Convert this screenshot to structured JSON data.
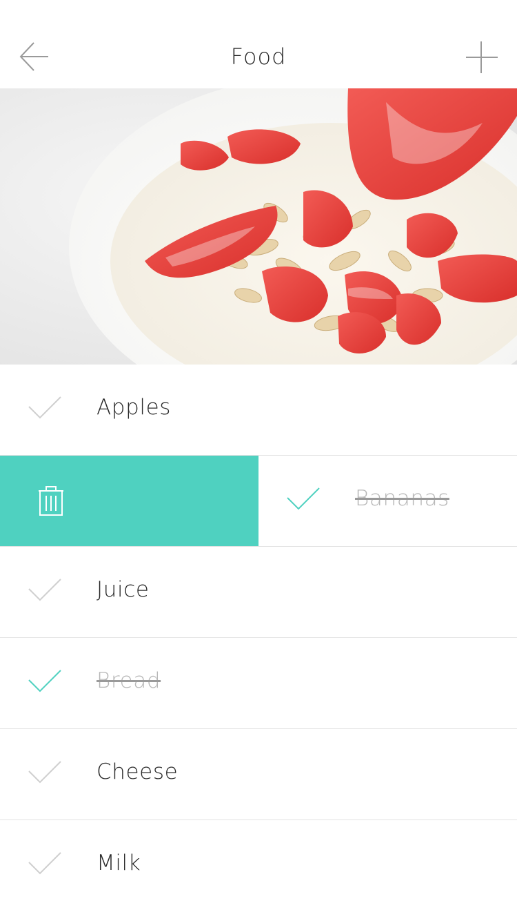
{
  "header": {
    "title": "Food",
    "back_icon": "arrow-left-icon",
    "add_icon": "plus-icon"
  },
  "hero": {
    "image": "yogurt-strawberries-oats-photo"
  },
  "colors": {
    "accent": "#4fd1c0",
    "check_inactive": "#cfcfcf",
    "check_done": "#4fd1c0",
    "done_text": "#b7b7b7"
  },
  "items": [
    {
      "label": "Apples",
      "done": false
    },
    {
      "label": "Bananas",
      "done": true,
      "swiped": true,
      "action_icon": "trash-icon"
    },
    {
      "label": "Juice",
      "done": false
    },
    {
      "label": "Bread",
      "done": true
    },
    {
      "label": "Cheese",
      "done": false
    },
    {
      "label": "Milk",
      "done": false
    }
  ]
}
